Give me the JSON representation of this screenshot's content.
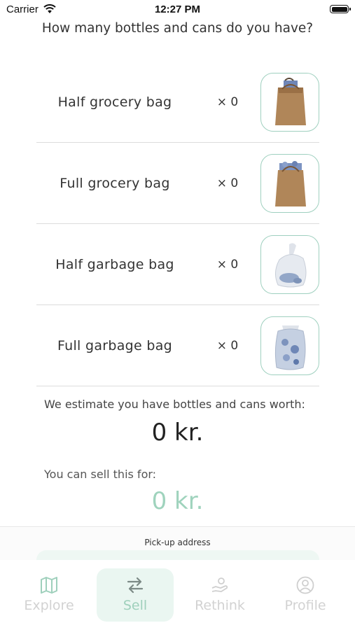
{
  "status_bar": {
    "carrier": "Carrier",
    "time": "12:27 PM"
  },
  "question": "How many bottles and cans do you have?",
  "items": [
    {
      "label": "Half grocery bag",
      "qty": "× 0",
      "image": "grocery-bag-half-image"
    },
    {
      "label": "Full grocery bag",
      "qty": "× 0",
      "image": "grocery-bag-full-image"
    },
    {
      "label": "Half garbage bag",
      "qty": "× 0",
      "image": "garbage-bag-half-image"
    },
    {
      "label": "Full garbage bag",
      "qty": "× 0",
      "image": "garbage-bag-full-image"
    }
  ],
  "estimate": {
    "label": "We estimate you have bottles and cans worth:",
    "value": "0 kr."
  },
  "sell": {
    "label": "You can sell this for:",
    "value": "0 kr."
  },
  "pickup": {
    "title": "Pick-up address"
  },
  "tabs": [
    {
      "label": "Explore",
      "icon": "map-icon",
      "active": false
    },
    {
      "label": "Sell",
      "icon": "swap-arrows-icon",
      "active": true
    },
    {
      "label": "Rethink",
      "icon": "hand-recycle-icon",
      "active": false
    },
    {
      "label": "Profile",
      "icon": "profile-icon",
      "active": false
    }
  ],
  "colors": {
    "accent": "#9fd0bc",
    "accent_bg": "#eaf6f1",
    "inactive": "#d2d2d2",
    "thumb_border": "#9fd0bf"
  }
}
